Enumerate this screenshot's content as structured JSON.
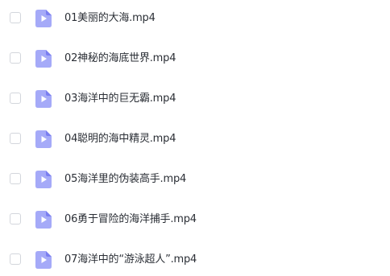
{
  "files": [
    {
      "name": "01美丽的大海.mp4",
      "icon": "video-file-icon"
    },
    {
      "name": "02神秘的海底世界.mp4",
      "icon": "video-file-icon"
    },
    {
      "name": "03海洋中的巨无霸.mp4",
      "icon": "video-file-icon"
    },
    {
      "name": "04聪明的海中精灵.mp4",
      "icon": "video-file-icon"
    },
    {
      "name": "05海洋里的伪装高手.mp4",
      "icon": "video-file-icon"
    },
    {
      "name": "06勇于冒险的海洋捕手.mp4",
      "icon": "video-file-icon"
    },
    {
      "name": "07海洋中的“游泳超人”.mp4",
      "icon": "video-file-icon"
    }
  ],
  "colors": {
    "icon_light": "#a5aaf8",
    "icon_dark": "#7b7ff0",
    "text": "#2b2f36",
    "checkbox_border": "#d3d6dc"
  }
}
